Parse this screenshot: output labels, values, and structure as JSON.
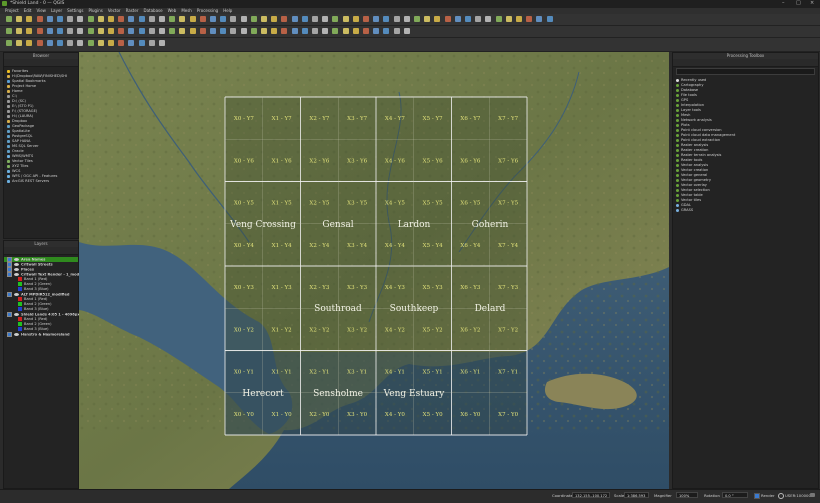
{
  "window": {
    "title": "*Shield Land - 0 — QGIS"
  },
  "menu": [
    "Project",
    "Edit",
    "View",
    "Layer",
    "Settings",
    "Plugins",
    "Vector",
    "Raster",
    "Database",
    "Web",
    "Mesh",
    "Processing",
    "Help"
  ],
  "browser": {
    "title": "Browser",
    "items": [
      {
        "label": "Favorites",
        "icon": "star-icon"
      },
      {
        "label": "H:\\Dropbox\\RAW\\FINISHED\\SHI",
        "icon": "folder-icon"
      },
      {
        "label": "Spatial Bookmarks",
        "icon": "bookmark-icon"
      },
      {
        "label": "Project Home",
        "icon": "folder-icon"
      },
      {
        "label": "Home",
        "icon": "folder-icon"
      },
      {
        "label": "C:\\",
        "icon": "drive-icon"
      },
      {
        "label": "D:\\ (SC)",
        "icon": "drive-icon"
      },
      {
        "label": "E:\\ (STO P1)",
        "icon": "drive-icon"
      },
      {
        "label": "F:\\ (STORAGE)",
        "icon": "drive-icon"
      },
      {
        "label": "H:\\ (LAURA)",
        "icon": "drive-icon"
      },
      {
        "label": "Dropbox",
        "icon": "folder-icon"
      },
      {
        "label": "GeoPackage",
        "icon": "database-icon"
      },
      {
        "label": "SpatiaLite",
        "icon": "database-icon"
      },
      {
        "label": "PostgreSQL",
        "icon": "database-icon"
      },
      {
        "label": "SAP HANA",
        "icon": "database-icon"
      },
      {
        "label": "MS SQL Server",
        "icon": "database-icon"
      },
      {
        "label": "Oracle",
        "icon": "database-icon"
      },
      {
        "label": "WMS/WMTS",
        "icon": "globe-icon"
      },
      {
        "label": "Vector Tiles",
        "icon": "grid-icon"
      },
      {
        "label": "XYZ Tiles",
        "icon": "grid-icon"
      },
      {
        "label": "WCS",
        "icon": "globe-icon"
      },
      {
        "label": "WFS / OGC API - Features",
        "icon": "globe-icon"
      },
      {
        "label": "ArcGIS REST Servers",
        "icon": "globe-icon"
      }
    ]
  },
  "layers": {
    "title": "Layers",
    "items": [
      {
        "label": "Area Names",
        "bold": true,
        "selected": true
      },
      {
        "label": "Critwall Streets",
        "bold": true
      },
      {
        "label": "Places",
        "bold": true
      },
      {
        "label": "Critwall Text Render - 1_modi",
        "bold": true
      },
      {
        "label": "Band 1 (Red)",
        "swatch": "#d32020"
      },
      {
        "label": "Band 2 (Green)",
        "swatch": "#20c020"
      },
      {
        "label": "Band 3 (Blue)",
        "swatch": "#2040d0"
      },
      {
        "label": "ALT MPDIR512_modified",
        "bold": true
      },
      {
        "label": "Band 1 (Red)",
        "swatch": "#d32020"
      },
      {
        "label": "Band 2 (Green)",
        "swatch": "#20c020"
      },
      {
        "label": "Band 3 (Blue)",
        "swatch": "#2040d0"
      },
      {
        "label": "Shield Lands 4:05 1 - 4096px",
        "bold": true
      },
      {
        "label": "Band 1 (Red)",
        "swatch": "#d32020"
      },
      {
        "label": "Band 2 (Green)",
        "swatch": "#20c020"
      },
      {
        "label": "Band 3 (Blue)",
        "swatch": "#2040d0"
      },
      {
        "label": "Hanstro & Haymoreland",
        "bold": true
      }
    ]
  },
  "processing": {
    "title": "Processing Toolbox",
    "items": [
      "Recently used",
      "Cartography",
      "Database",
      "File tools",
      "GPS",
      "Interpolation",
      "Layer tools",
      "Mesh",
      "Network analysis",
      "Plots",
      "Point cloud conversion",
      "Point cloud data management",
      "Point cloud extraction",
      "Raster analysis",
      "Raster creation",
      "Raster terrain analysis",
      "Raster tools",
      "Vector analysis",
      "Vector creation",
      "Vector general",
      "Vector geometry",
      "Vector overlay",
      "Vector selection",
      "Vector table",
      "Vector tiles",
      "GDAL",
      "GRASS"
    ]
  },
  "map": {
    "grid_labels": [
      [
        "X0 - Y7",
        "X1 - Y7",
        "X2 - Y7",
        "X3 - Y7",
        "X4 - Y7",
        "X5 - Y7",
        "X6 - Y7",
        "X7 - Y7"
      ],
      [
        "X0 - Y6",
        "X1 - Y6",
        "X2 - Y6",
        "X3 - Y6",
        "X4 - Y6",
        "X5 - Y6",
        "X6 - Y6",
        "X7 - Y6"
      ],
      [
        "X0 - Y5",
        "X1 - Y5",
        "X2 - Y5",
        "X3 - Y5",
        "X4 - Y5",
        "X5 - Y5",
        "X6 - Y5",
        "X7 - Y5"
      ],
      [
        "X0 - Y4",
        "X1 - Y4",
        "X2 - Y4",
        "X3 - Y4",
        "X4 - Y4",
        "X5 - Y4",
        "X6 - Y4",
        "X7 - Y4"
      ],
      [
        "X0 - Y3",
        "X1 - Y3",
        "X2 - Y3",
        "X3 - Y3",
        "X4 - Y3",
        "X5 - Y3",
        "X6 - Y3",
        "X7 - Y3"
      ],
      [
        "X0 - Y2",
        "X1 - Y2",
        "X2 - Y2",
        "X3 - Y2",
        "X4 - Y2",
        "X5 - Y2",
        "X6 - Y2",
        "X7 - Y2"
      ],
      [
        "X0 - Y1",
        "X1 - Y1",
        "X2 - Y1",
        "X3 - Y1",
        "X4 - Y1",
        "X5 - Y1",
        "X6 - Y1",
        "X7 - Y1"
      ],
      [
        "X0 - Y0",
        "X1 - Y0",
        "X2 - Y0",
        "X3 - Y0",
        "X4 - Y0",
        "X5 - Y0",
        "X6 - Y0",
        "X7 - Y0"
      ]
    ],
    "regions": {
      "veng_crossing": "Veng Crossing",
      "gensal": "Gensal",
      "lardon": "Lardon",
      "goherin": "Goherin",
      "southroad": "Southroad",
      "southkeep": "Southkeep",
      "delard": "Delard",
      "herecort": "Herecort",
      "sensholme": "Sensholme",
      "veng_estuary": "Veng Estuary"
    }
  },
  "status": {
    "coordinate_label": "Coordinate",
    "coordinate": "132,155,-100,172",
    "scale_label": "Scale",
    "scale": "1:386,593",
    "magnifier_label": "Magnifier",
    "magnifier": "100%",
    "rotation_label": "Rotation",
    "rotation": "0.0 °",
    "render_label": "Render",
    "crs": "USER:100000"
  },
  "colors": {
    "ocean": "#3d5a73",
    "land": "#6f7a48",
    "grid_label": "#e2e27a",
    "selected_layer": "#2f8a1e"
  }
}
